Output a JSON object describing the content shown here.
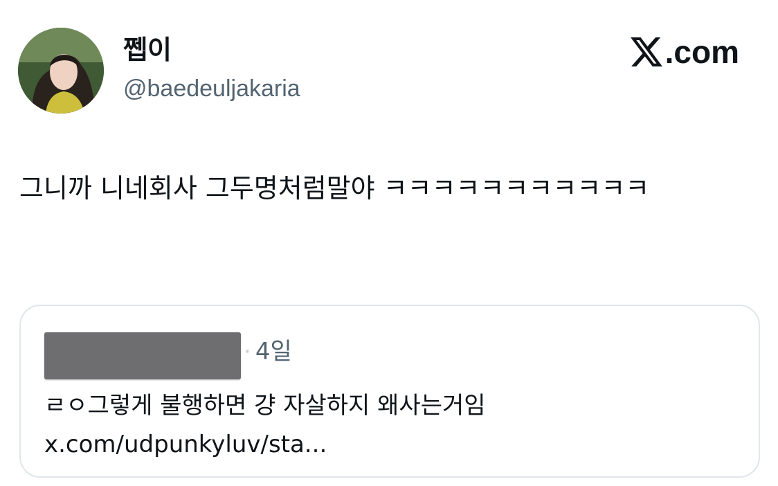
{
  "author": {
    "display_name": "쩹이",
    "handle": "@baedeuljakaria",
    "avatar_icon": "profile-photo"
  },
  "brand": {
    "logo_icon": "x-logo-icon",
    "suffix": ".com"
  },
  "tweet": {
    "text": "그니까 니네회사 그두명처럼말야 ㅋㅋㅋㅋㅋㅋㅋㅋㅋㅋㅋ"
  },
  "quoted_tweet": {
    "author_redacted": true,
    "separator": "·",
    "time_ago": "4일",
    "text": "ㄹㅇ그렇게 불행하면 걍 자살하지 왜사는거임 x.com/udpunkyluv/sta..."
  },
  "colors": {
    "text_primary": "#0f1419",
    "text_secondary": "#536471",
    "card_border": "#e1e6ea",
    "redaction": "#6e6e70"
  }
}
